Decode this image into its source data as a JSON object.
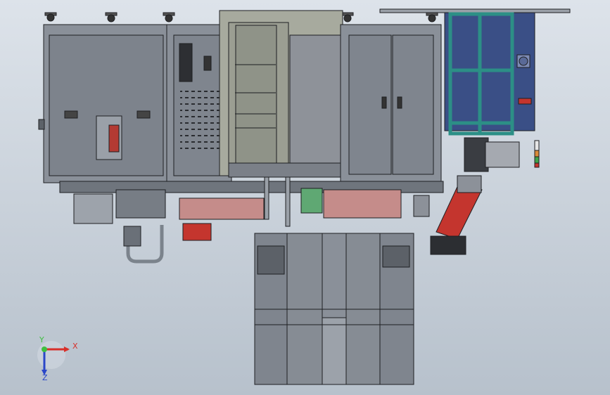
{
  "viewport": {
    "background_top": "#dde3ea",
    "background_bottom": "#b7c1cc"
  },
  "triad": {
    "x_label": "X",
    "y_label": "Y",
    "z_label": "Z",
    "x_color": "#d8302a",
    "y_color": "#3fbf3f",
    "z_color": "#2a46c8"
  },
  "colors": {
    "cabinet_fill": "#8a9099",
    "cabinet_dark": "#5c6168",
    "line": "#1e1f22",
    "glass": "#a7aa9e",
    "teal_frame": "#2c8f86",
    "blue_panel": "#3a4f86",
    "robot_red": "#c4352e",
    "green_part": "#5fa873",
    "pink_part": "#c58c8a"
  },
  "icons": [
    "caster-wheel-icon",
    "door-handle-icon",
    "signal-tower-icon",
    "axis-triad-icon"
  ]
}
